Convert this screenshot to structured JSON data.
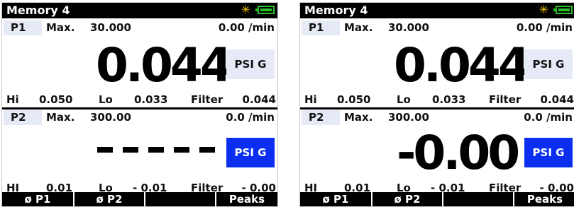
{
  "screens": [
    {
      "title": "Memory 4",
      "p1": {
        "tag": "P1",
        "max_label": "Max.",
        "max_value": "30.000",
        "rate": "0.00 /min",
        "reading": "0.044",
        "unit": "PSI G",
        "hi_label": "Hi",
        "hi_value": "0.050",
        "lo_label": "Lo",
        "lo_value": "0.033",
        "filter_label": "Filter",
        "filter_value": "0.044"
      },
      "p2": {
        "tag": "P2",
        "max_label": "Max.",
        "max_value": "300.00",
        "rate": "0.0 /min",
        "reading": "",
        "unit": "PSI G",
        "hi_label": "HI",
        "hi_value": "0.01",
        "lo_label": "Lo",
        "lo_value": "- 0.01",
        "filter_label": "Filter",
        "filter_value": "- 0.00"
      },
      "softkeys": [
        "ø P1",
        "ø P2",
        "",
        "Peaks"
      ]
    },
    {
      "title": "Memory 4",
      "p1": {
        "tag": "P1",
        "max_label": "Max.",
        "max_value": "30.000",
        "rate": "0.00 /min",
        "reading": "0.044",
        "unit": "PSI G",
        "hi_label": "Hi",
        "hi_value": "0.050",
        "lo_label": "Lo",
        "lo_value": "0.033",
        "filter_label": "Filter",
        "filter_value": "0.044"
      },
      "p2": {
        "tag": "P2",
        "max_label": "Max.",
        "max_value": "300.00",
        "rate": "0.0 /min",
        "reading": "-0.00",
        "unit": "PSI G",
        "hi_label": "HI",
        "hi_value": "0.01",
        "lo_label": "Lo",
        "lo_value": "- 0.01",
        "filter_label": "Filter",
        "filter_value": "- 0.00"
      },
      "softkeys": [
        "ø P1",
        "ø P2",
        "",
        "Peaks"
      ]
    }
  ],
  "colors": {
    "unit_highlight": "#0b2ef0",
    "tag_bg": "#e6e9f6",
    "battery": "#27c127",
    "sun": "#f2c500"
  },
  "icons": {
    "status_sun": "sun-icon",
    "battery": "battery-icon"
  }
}
